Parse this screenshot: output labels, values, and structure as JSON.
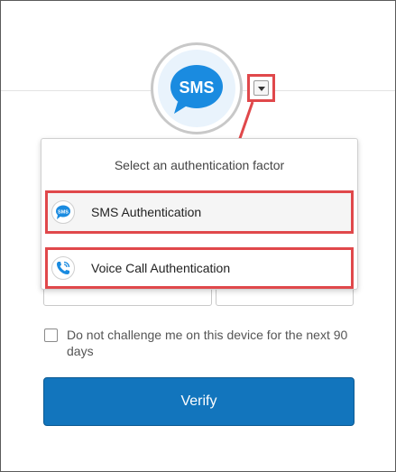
{
  "header": {
    "logo_text": "SMS"
  },
  "factor_menu": {
    "title": "Select an authentication factor",
    "options": [
      {
        "label": "SMS Authentication",
        "icon": "sms-icon",
        "icon_text": "SMS"
      },
      {
        "label": "Voice Call Authentication",
        "icon": "phone-icon"
      }
    ]
  },
  "remember_device": {
    "label": "Do not challenge me on this device for the next 90 days",
    "checked": false
  },
  "verify_button": {
    "label": "Verify"
  },
  "colors": {
    "accent": "#1275bd",
    "highlight": "#e0484b",
    "sms_bubble": "#1a8be0"
  }
}
